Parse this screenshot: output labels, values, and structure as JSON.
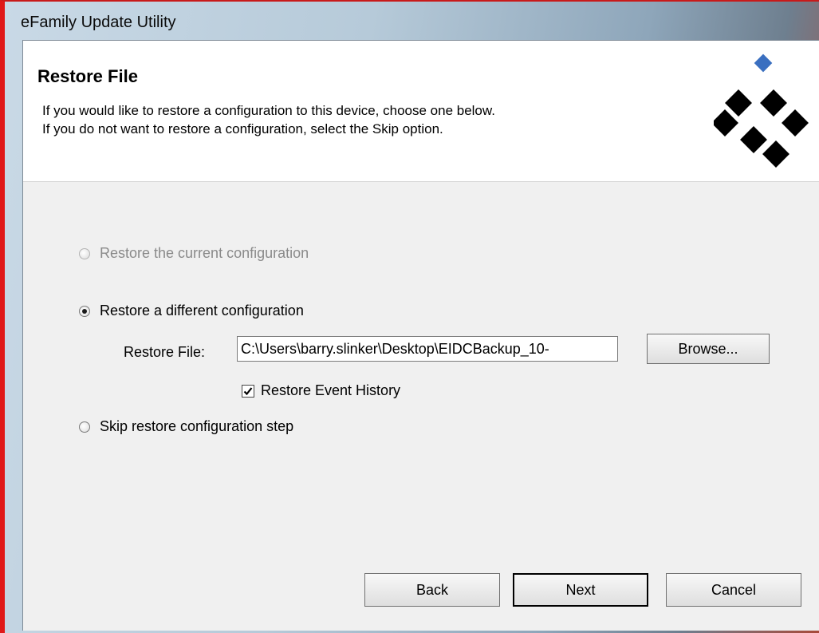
{
  "window": {
    "title": "eFamily Update Utility"
  },
  "header": {
    "title": "Restore File",
    "description_line1": "If you would like to restore a configuration to this device, choose one below.",
    "description_line2": "If you do not want to restore a configuration, select the Skip option."
  },
  "options": [
    {
      "label": "Restore the current configuration",
      "selected": false,
      "enabled": false
    },
    {
      "label": "Restore a different configuration",
      "selected": true,
      "enabled": true
    },
    {
      "label": "Skip restore configuration step",
      "selected": false,
      "enabled": true
    }
  ],
  "restore_file": {
    "label": "Restore File:",
    "value": "C:\\Users\\barry.slinker\\Desktop\\EIDCBackup_10-",
    "browse_label": "Browse..."
  },
  "event_history": {
    "label": "Restore Event History",
    "checked": true
  },
  "buttons": {
    "back": "Back",
    "next": "Next",
    "cancel": "Cancel"
  },
  "colors": {
    "logo_accent": "#3a6fc0",
    "logo_dark": "#000000",
    "window_border": "#e01818"
  },
  "icons": {
    "logo": "diamond-grid-logo",
    "checkbox_mark": "checkmark-icon"
  }
}
